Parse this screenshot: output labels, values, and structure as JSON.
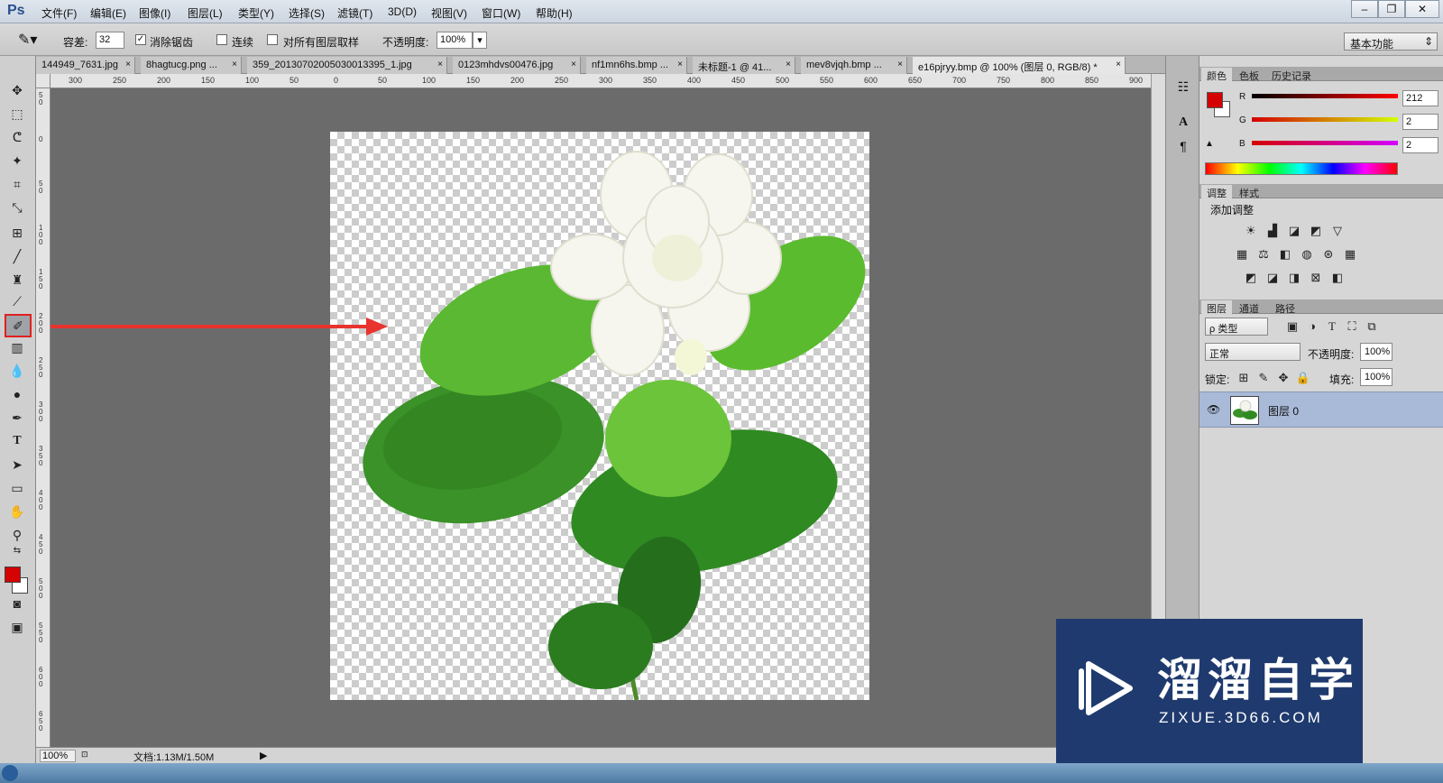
{
  "app": {
    "logo": "Ps"
  },
  "menu": [
    "文件(F)",
    "编辑(E)",
    "图像(I)",
    "图层(L)",
    "类型(Y)",
    "选择(S)",
    "滤镜(T)",
    "3D(D)",
    "视图(V)",
    "窗口(W)",
    "帮助(H)"
  ],
  "window_controls": {
    "minimize": "–",
    "restore": "❐",
    "close": "✕"
  },
  "options": {
    "tolerance_label": "容差:",
    "tolerance_value": "32",
    "antialias_label": "消除锯齿",
    "antialias_checked": "✓",
    "contiguous_label": "连续",
    "all_layers_label": "对所有图层取样",
    "opacity_label": "不透明度:",
    "opacity_value": "100%"
  },
  "workspace": "基本功能",
  "doc_tabs": [
    {
      "label": "144949_7631.jpg"
    },
    {
      "label": "8hagtucg.png ..."
    },
    {
      "label": "359_20130702005030013395_1.jpg"
    },
    {
      "label": "0123mhdvs00476.jpg"
    },
    {
      "label": "nf1mn6hs.bmp ..."
    },
    {
      "label": "未标题-1 @ 41..."
    },
    {
      "label": "mev8vjqh.bmp ..."
    },
    {
      "label": "e16pjryy.bmp @ 100% (图层 0, RGB/8) *"
    }
  ],
  "tab_close": "×",
  "tab_overflow": "»",
  "ruler_top": [
    "300",
    "250",
    "200",
    "150",
    "100",
    "50",
    "0",
    "50",
    "100",
    "150",
    "200",
    "250",
    "300",
    "350",
    "400",
    "450",
    "500",
    "550",
    "600",
    "650",
    "700",
    "750",
    "800",
    "850",
    "900"
  ],
  "ruler_left": [
    "50",
    "0",
    "50",
    "100",
    "150",
    "200",
    "250",
    "300",
    "350",
    "400",
    "450",
    "500",
    "550",
    "600",
    "650"
  ],
  "status": {
    "zoom": "100%",
    "doc_info": "文档:1.13M/1.50M",
    "arrow": "▶"
  },
  "foreground_color": "#d40202",
  "background_color": "#ffffff",
  "color_panel": {
    "tabs": [
      "颜色",
      "色板",
      "历史记录"
    ],
    "r_label": "R",
    "r_value": "212",
    "g_label": "G",
    "g_value": "2",
    "b_label": "B",
    "b_value": "2"
  },
  "adjust_panel": {
    "tabs": [
      "调整",
      "样式"
    ],
    "title": "添加调整"
  },
  "layers_panel": {
    "tabs": [
      "图层",
      "通道",
      "路径"
    ],
    "filter": "ρ 类型",
    "blend_mode": "正常",
    "opacity_label": "不透明度:",
    "opacity_value": "100%",
    "lock_label": "锁定:",
    "fill_label": "填充:",
    "fill_value": "100%",
    "layer_name": "图层 0"
  },
  "watermark": {
    "title": "溜溜自学",
    "url": "ZIXUE.3D66.COM"
  }
}
